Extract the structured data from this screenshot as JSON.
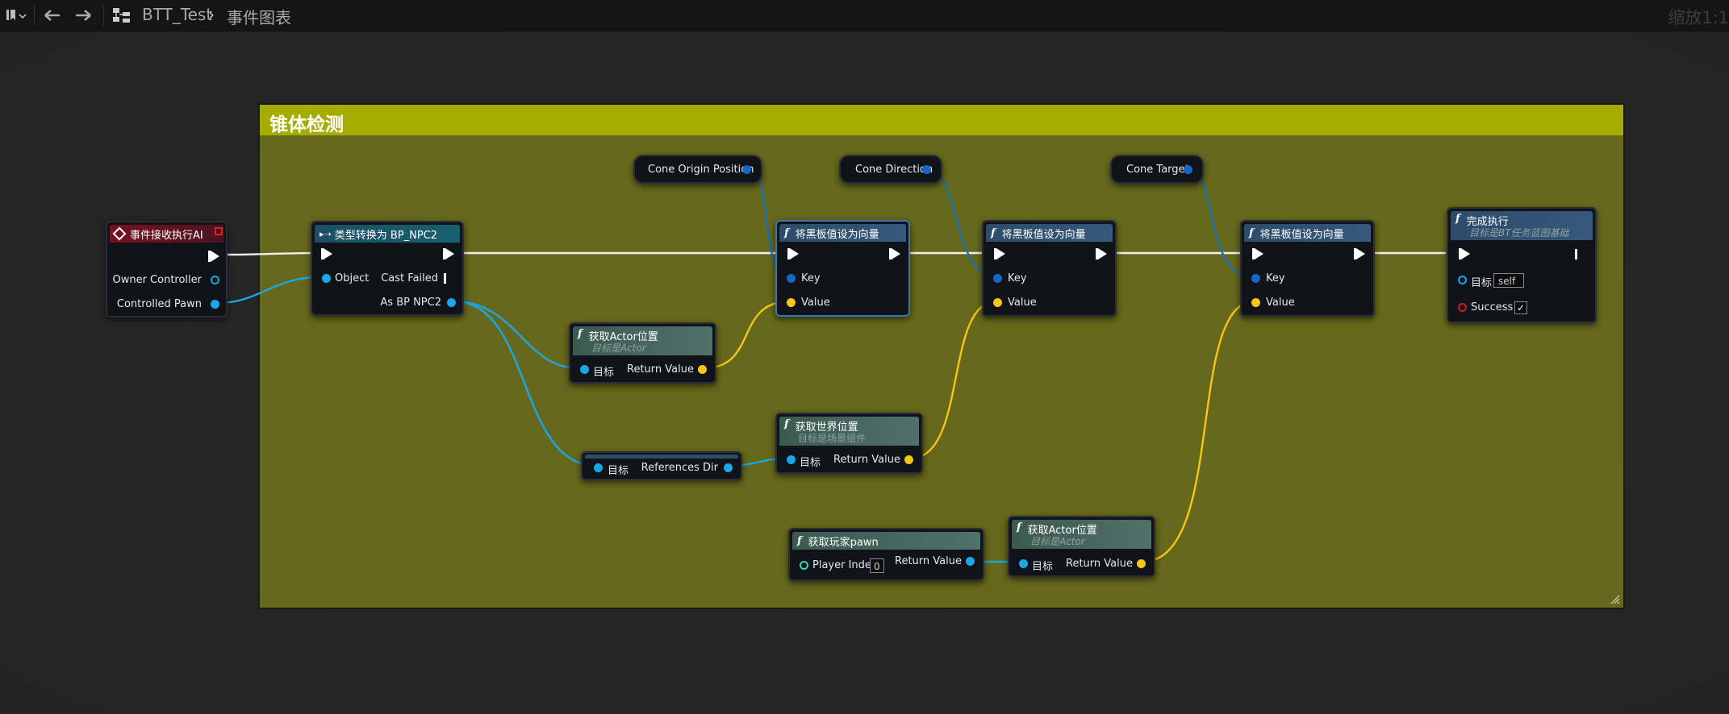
{
  "toolbar": {
    "breadcrumb_blueprint": "BTT_Test",
    "breadcrumb_graph": "事件图表",
    "zoom": "缩放1:1"
  },
  "comment": {
    "title": "锥体检测"
  },
  "nodes": {
    "event": {
      "title": "事件接收执行AI",
      "owner_controller": "Owner Controller",
      "controlled_pawn": "Controlled Pawn"
    },
    "cast": {
      "title": "类型转换为 BP_NPC2",
      "object": "Object",
      "cast_failed": "Cast Failed",
      "as_bp": "As BP NPC2"
    },
    "var_origin": {
      "label": "Cone Origin Position"
    },
    "var_direction": {
      "label": "Cone Direction"
    },
    "var_target": {
      "label": "Cone Target"
    },
    "set1": {
      "title": "将黑板值设为向量",
      "key": "Key",
      "value": "Value"
    },
    "set2": {
      "title": "将黑板值设为向量",
      "key": "Key",
      "value": "Value"
    },
    "set3": {
      "title": "将黑板值设为向量",
      "key": "Key",
      "value": "Value"
    },
    "finish": {
      "title": "完成执行",
      "subtitle": "目标是BT任务蓝图基础",
      "target": "目标",
      "target_value": "self",
      "success": "Success",
      "success_checked": "✓"
    },
    "get_actor_loc1": {
      "title": "获取Actor位置",
      "subtitle": "目标是Actor",
      "target": "目标",
      "return": "Return Value"
    },
    "ref_dir": {
      "target": "目标",
      "label": "References Dir"
    },
    "world_loc": {
      "title": "获取世界位置",
      "subtitle": "目标是场景组件",
      "target": "目标",
      "return": "Return Value"
    },
    "player_pawn": {
      "title": "获取玩家pawn",
      "player_index": "Player Index",
      "index_value": "0",
      "return": "Return Value"
    },
    "get_actor_loc2": {
      "title": "获取Actor位置",
      "subtitle": "目标是Actor",
      "target": "目标",
      "return": "Return Value"
    }
  },
  "colors": {
    "comment_header": "#a7ad00",
    "comment_body": "#66681c",
    "event_header": "#7a1020",
    "cast_header": "#1b4f66",
    "function_header": "#2c4c6a",
    "pure_header": "#3c5a50",
    "object_pin": "#1aa7e8",
    "vector_pin": "#f5c518",
    "key_pin": "#1866c8"
  }
}
